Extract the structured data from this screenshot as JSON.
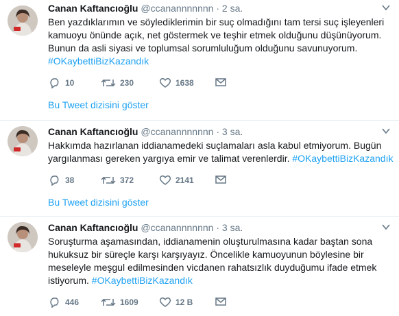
{
  "tweets": [
    {
      "name": "Canan Kaftancıoğlu",
      "handle": "@ccanannnnnnn",
      "separator": "·",
      "time": "2 sa.",
      "text": "Ben yazdıklarımın ve söylediklerimin bir suç olmadığını tam tersi suç işleyenleri kamuoyu önünde açık, net göstermek ve teşhir etmek olduğunu düşünüyorum. Bunun da asli siyasi ve toplumsal sorumluluğum olduğunu savunuyorum.",
      "hashtag": "#OKaybettiBizKazandık",
      "replies": "10",
      "retweets": "230",
      "likes": "1638",
      "thread_link": "Bu Tweet dizisini göster"
    },
    {
      "name": "Canan Kaftancıoğlu",
      "handle": "@ccanannnnnnn",
      "separator": "·",
      "time": "3 sa.",
      "text": "Hakkımda hazırlanan iddianamedeki suçlamaları asla kabul etmiyorum. Bugün yargılanması gereken yargıya emir ve talimat verenlerdir.",
      "hashtag": "#OKaybettiBizKazandık",
      "replies": "38",
      "retweets": "372",
      "likes": "2141",
      "thread_link": "Bu Tweet dizisini göster"
    },
    {
      "name": "Canan Kaftancıoğlu",
      "handle": "@ccanannnnnnn",
      "separator": "·",
      "time": "3 sa.",
      "text": "Soruşturma aşamasından,  iddianamenin oluşturulmasına kadar baştan sona hukuksuz bir süreçle karşı karşıyayız. Öncelikle kamuoyunun böylesine bir meseleyle meşgul edilmesinden vicdanen rahatsızlık duyduğumu ifade etmek istiyorum.",
      "hashtag": "#OKaybettiBizKazandık",
      "replies": "446",
      "retweets": "1609",
      "likes": "12 B"
    }
  ],
  "colors": {
    "accent": "#1da1f2",
    "muted": "#657786",
    "text": "#14171a",
    "border": "#e6ecf0"
  },
  "icons": [
    "chevron-down-icon",
    "reply-icon",
    "retweet-icon",
    "heart-icon",
    "message-icon"
  ]
}
